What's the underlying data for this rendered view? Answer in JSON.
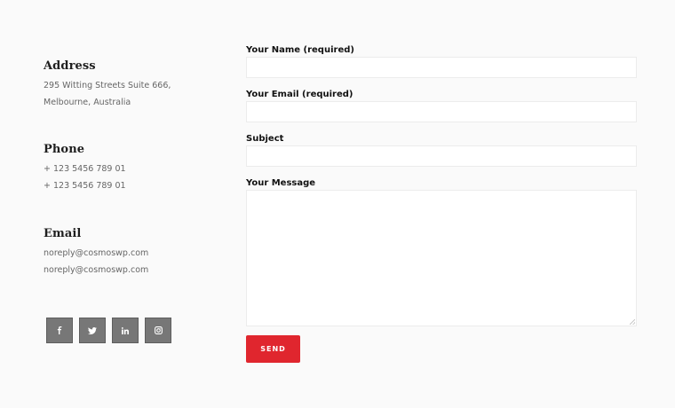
{
  "contact": {
    "address": {
      "heading": "Address",
      "lines": [
        "295 Witting Streets Suite 666,",
        "Melbourne, Australia"
      ]
    },
    "phone": {
      "heading": "Phone",
      "lines": [
        "+ 123 5456 789 01",
        "+ 123 5456 789 01"
      ]
    },
    "email": {
      "heading": "Email",
      "lines": [
        "noreply@cosmoswp.com",
        "noreply@cosmoswp.com"
      ]
    }
  },
  "social": [
    {
      "name": "facebook-icon",
      "glyph": "f"
    },
    {
      "name": "twitter-icon",
      "glyph": "t"
    },
    {
      "name": "linkedin-icon",
      "glyph": "in"
    },
    {
      "name": "instagram-icon",
      "glyph": "ig"
    }
  ],
  "form": {
    "name_label": "Your Name (required)",
    "name_value": "",
    "email_label": "Your Email (required)",
    "email_value": "",
    "subject_label": "Subject",
    "subject_value": "",
    "message_label": "Your Message",
    "message_value": "",
    "send_label": "SEND"
  },
  "colors": {
    "accent": "#e0262e",
    "social_bg": "#777777",
    "page_bg": "#fafafa"
  }
}
